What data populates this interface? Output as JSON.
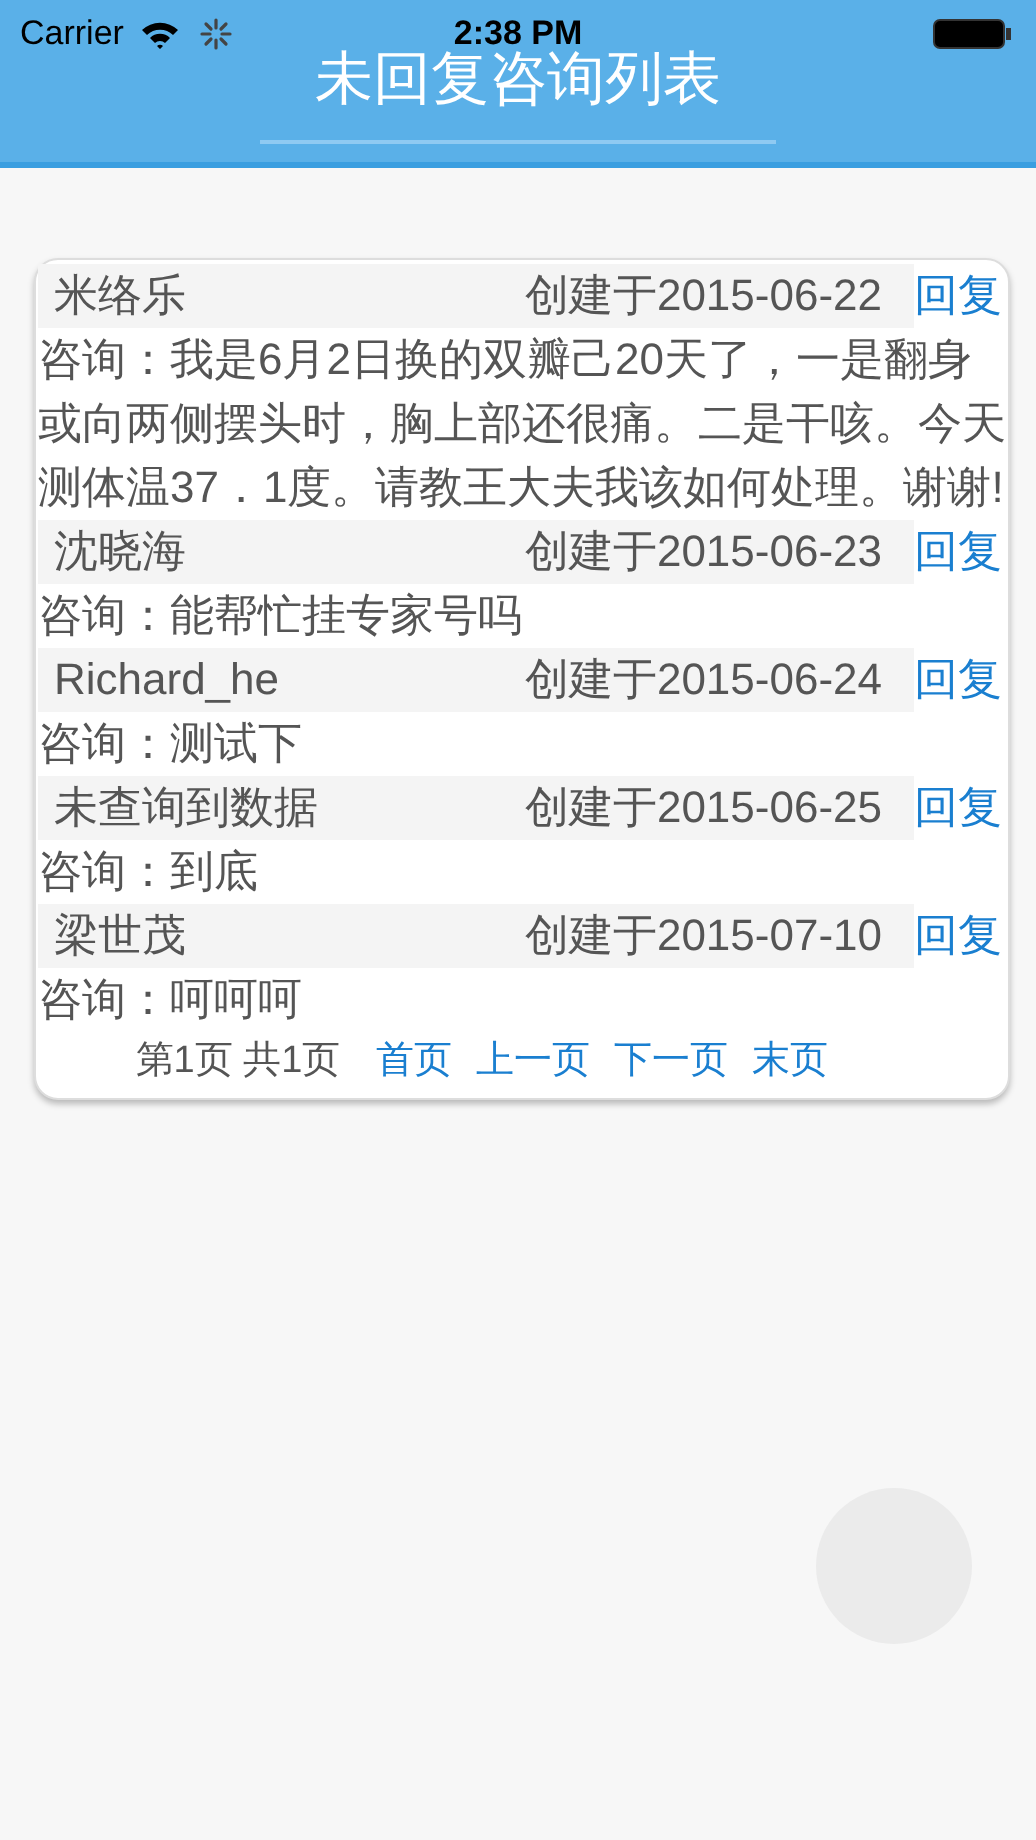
{
  "status_bar": {
    "carrier": "Carrier",
    "time": "2:38 PM"
  },
  "title": "未回复咨询列表",
  "items": [
    {
      "name": "米络乐",
      "created": "创建于2015-06-22",
      "reply": "回复",
      "question": "咨询：我是6月2日换的双瓣己20天了，一是翻身或向两侧摆头时，胸上部还很痛。二是干咳。今天测体温37．1度。请教王大夫我该如何处理。谢谢!"
    },
    {
      "name": "沈晓海",
      "created": "创建于2015-06-23",
      "reply": "回复",
      "question": "咨询：能帮忙挂专家号吗"
    },
    {
      "name": "Richard_he",
      "created": "创建于2015-06-24",
      "reply": "回复",
      "question": "咨询：测试下"
    },
    {
      "name": "未查询到数据",
      "created": "创建于2015-06-25",
      "reply": "回复",
      "question": "咨询：到底"
    },
    {
      "name": "梁世茂",
      "created": "创建于2015-07-10",
      "reply": "回复",
      "question": "咨询：呵呵呵"
    }
  ],
  "pager": {
    "info": "第1页 共1页",
    "links": [
      "首页",
      "上一页",
      "下一页",
      "末页"
    ]
  }
}
